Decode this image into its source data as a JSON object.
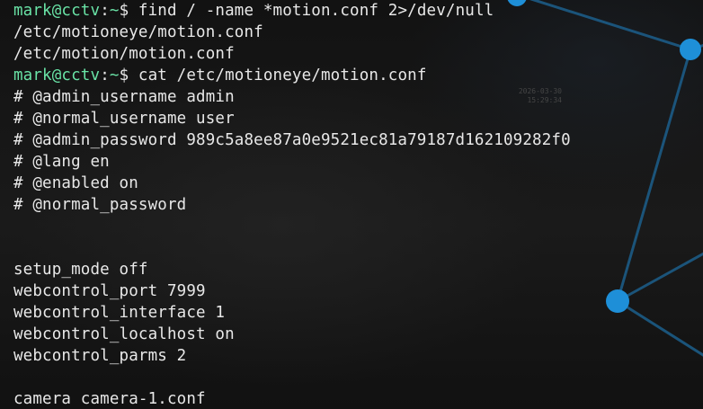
{
  "terminal": {
    "lines": [
      {
        "type": "prompt",
        "user_host": "mark@cctv",
        "path": "~",
        "symbol": "$",
        "command": " find / -name *motion.conf 2>/dev/null"
      },
      {
        "type": "output",
        "text": "/etc/motioneye/motion.conf"
      },
      {
        "type": "output",
        "text": "/etc/motion/motion.conf"
      },
      {
        "type": "prompt",
        "user_host": "mark@cctv",
        "path": "~",
        "symbol": "$",
        "command": " cat /etc/motioneye/motion.conf"
      },
      {
        "type": "output",
        "text": "# @admin_username admin"
      },
      {
        "type": "output",
        "text": "# @normal_username user"
      },
      {
        "type": "output",
        "text": "# @admin_password 989c5a8ee87a0e9521ec81a79187d162109282f0"
      },
      {
        "type": "output",
        "text": "# @lang en"
      },
      {
        "type": "output",
        "text": "# @enabled on"
      },
      {
        "type": "output",
        "text": "# @normal_password"
      },
      {
        "type": "output",
        "text": ""
      },
      {
        "type": "output",
        "text": ""
      },
      {
        "type": "output",
        "text": "setup_mode off"
      },
      {
        "type": "output",
        "text": "webcontrol_port 7999"
      },
      {
        "type": "output",
        "text": "webcontrol_interface 1"
      },
      {
        "type": "output",
        "text": "webcontrol_localhost on"
      },
      {
        "type": "output",
        "text": "webcontrol_parms 2"
      },
      {
        "type": "output",
        "text": ""
      },
      {
        "type": "output",
        "text": "camera camera-1.conf"
      }
    ]
  },
  "wallpaper": {
    "timestamp_date": "2026-03-30",
    "timestamp_time": "15:29:34",
    "node_color": "#1e8fd8",
    "edge_color": "#1c5f8c"
  },
  "colors": {
    "prompt_green": "#69e3a6",
    "text": "#e8e8e8",
    "background": "#141414"
  }
}
